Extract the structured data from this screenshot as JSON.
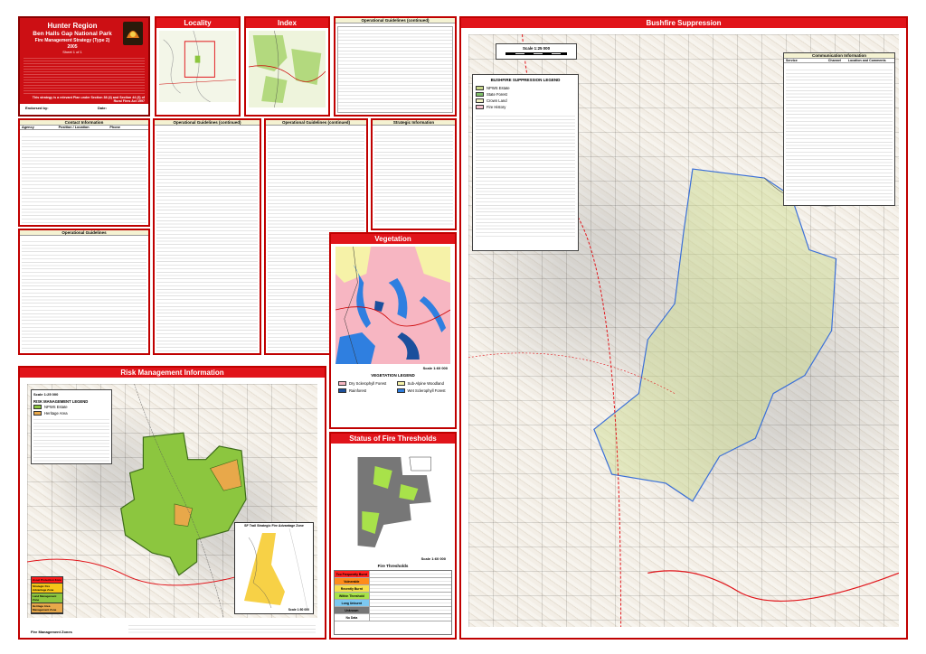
{
  "title_block": {
    "region": "Hunter Region",
    "park": "Ben Halls Gap National Park",
    "strategy": "Fire Management Strategy (Type 2)",
    "year": "2005",
    "sheet": "Sheet 1 of 1",
    "strategy_note": "This strategy is a relevant Plan under Section 38 (4) and Section 44 (3) of Rural Fires Act 1997",
    "prepared_label": "Endorsed by:",
    "date_label": "Date:"
  },
  "locality": {
    "title": "Locality"
  },
  "index": {
    "title": "Index"
  },
  "operational_continued_1": {
    "title": "Operational Guidelines (continued)"
  },
  "contact": {
    "title": "Contact Information",
    "cols": [
      "Agency",
      "Position / Location",
      "Phone"
    ]
  },
  "op_guidelines": {
    "title": "Operational Guidelines"
  },
  "op_continued_2": {
    "title": "Operational Guidelines (continued)"
  },
  "op_continued_3": {
    "title": "Operational Guidelines (continued)"
  },
  "strategic": {
    "title": "Strategic Information"
  },
  "bushfire": {
    "title": "Bushfire Suppression",
    "scale": "Scale 1:25 000",
    "legend_title": "BUSHFIRE SUPPRESSION LEGEND",
    "legend": [
      {
        "label": "NPWS Estate",
        "color": "#c9d98a"
      },
      {
        "label": "State Forest",
        "color": "#7fbf6a"
      },
      {
        "label": "Crown Land",
        "color": "#f0f0c0"
      },
      {
        "label": "Fire History",
        "color": "#f3c1cc"
      }
    ]
  },
  "vegetation": {
    "title": "Vegetation",
    "scale": "Scale 1:60 000",
    "legend_title": "VEGETATION LEGEND",
    "legend": [
      {
        "label": "Dry Sclerophyll Forest",
        "color": "#f7b6c2"
      },
      {
        "label": "Rainforest",
        "color": "#1b4f9c"
      },
      {
        "label": "Sub-Alpine Woodland",
        "color": "#f6f2a8"
      },
      {
        "label": "Wet Sclerophyll Forest",
        "color": "#2f7fe0"
      }
    ]
  },
  "fire_thresholds": {
    "title": "Status of Fire Thresholds",
    "scale": "Scale 1:60 000",
    "table_title": "Fire Thresholds",
    "rows": [
      {
        "label": "Too Frequently Burnt",
        "color": "#ff2020"
      },
      {
        "label": "Vulnerable",
        "color": "#ff8c1a"
      },
      {
        "label": "Recently Burnt",
        "color": "#f7e04a"
      },
      {
        "label": "Within Threshold",
        "color": "#a8e24a"
      },
      {
        "label": "Long Unburnt",
        "color": "#7cc8f0"
      },
      {
        "label": "Unknown",
        "color": "#777777"
      },
      {
        "label": "No Data",
        "color": "#ffffff"
      }
    ]
  },
  "risk": {
    "title": "Risk Management Information",
    "scale": "Scale 1:25 000",
    "legend_title": "RISK MANAGEMENT LEGEND",
    "legend": [
      {
        "label": "NPWS Estate",
        "color": "#8cc63f"
      },
      {
        "label": "Heritage Area",
        "color": "#e8a84a"
      }
    ],
    "inset_title": "SF Trail Strategic Fire Advantage Zone",
    "inset_scale": "Scale 1:50 000",
    "zone_title": "Fire Management Zones",
    "zones": [
      {
        "label": "Asset Protection Zone",
        "color": "#ff1a1a"
      },
      {
        "label": "Strategic Fire Advantage Zone",
        "color": "#f5c518"
      },
      {
        "label": "Land Management Zone",
        "color": "#8cc63f"
      },
      {
        "label": "Heritage Area Management Zone",
        "color": "#e8a84a"
      }
    ]
  },
  "communication": {
    "title": "Communication Information",
    "cols": [
      "Service",
      "Channel",
      "Location and Comments"
    ]
  }
}
